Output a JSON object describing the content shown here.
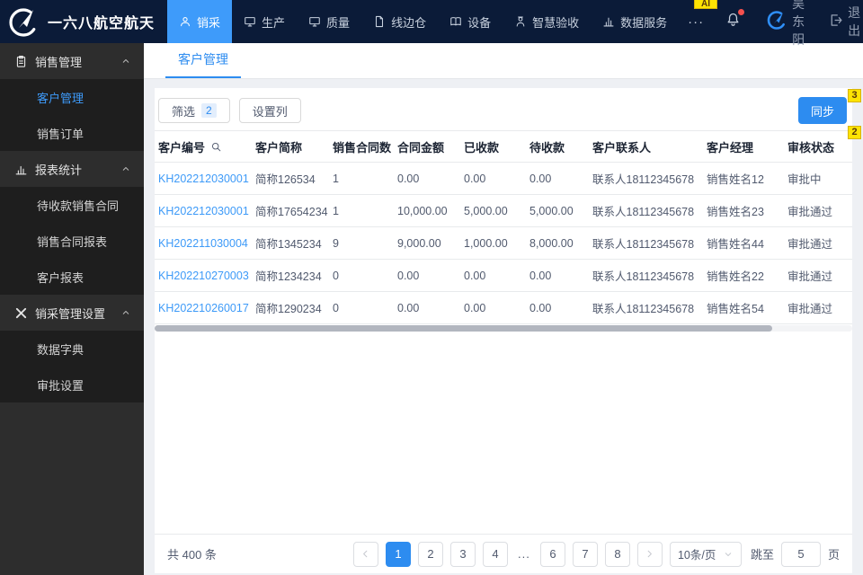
{
  "topbar": {
    "brand": "一六八航空航天",
    "nav": [
      {
        "label": "销采",
        "icon": "user-icon",
        "active": true
      },
      {
        "label": "生产",
        "icon": "monitor-icon",
        "active": false
      },
      {
        "label": "质量",
        "icon": "monitor-icon",
        "active": false
      },
      {
        "label": "线边仓",
        "icon": "doc-icon",
        "active": false
      },
      {
        "label": "设备",
        "icon": "book-icon",
        "active": false
      },
      {
        "label": "智慧验收",
        "icon": "inspector-icon",
        "active": false
      },
      {
        "label": "数据服务",
        "icon": "chart-icon",
        "active": false
      }
    ],
    "more": "···",
    "user": "吴东阳",
    "logout": "退出"
  },
  "sidebar": {
    "groups": [
      {
        "label": "销售管理",
        "icon": "clipboard-icon",
        "items": [
          {
            "label": "客户管理",
            "active": true
          },
          {
            "label": "销售订单",
            "active": false
          }
        ]
      },
      {
        "label": "报表统计",
        "icon": "bar-chart-icon",
        "items": [
          {
            "label": "待收款销售合同",
            "active": false
          },
          {
            "label": "销售合同报表",
            "active": false
          },
          {
            "label": "客户报表",
            "active": false
          }
        ]
      },
      {
        "label": "销采管理设置",
        "icon": "tools-icon",
        "items": [
          {
            "label": "数据字典",
            "active": false
          },
          {
            "label": "审批设置",
            "active": false
          }
        ]
      }
    ]
  },
  "main": {
    "tab": "客户管理",
    "toolbar": {
      "filter": "筛选",
      "filter_count": "2",
      "columns": "设置列",
      "sync": "同步"
    },
    "table": {
      "headers": [
        "客户编号",
        "客户简称",
        "销售合同数",
        "合同金额",
        "已收款",
        "待收款",
        "客户联系人",
        "客户经理",
        "审核状态"
      ],
      "rows": [
        [
          "KH202212030001",
          "简称126534",
          "1",
          "0.00",
          "0.00",
          "0.00",
          "联系人18112345678",
          "销售姓名12",
          "审批中"
        ],
        [
          "KH202212030001",
          "简称17654234",
          "1",
          "10,000.00",
          "5,000.00",
          "5,000.00",
          "联系人18112345678",
          "销售姓名23",
          "审批通过"
        ],
        [
          "KH202211030004",
          "简称1345234",
          "9",
          "9,000.00",
          "1,000.00",
          "8,000.00",
          "联系人18112345678",
          "销售姓名44",
          "审批通过"
        ],
        [
          "KH202210270003",
          "简称1234234",
          "0",
          "0.00",
          "0.00",
          "0.00",
          "联系人18112345678",
          "销售姓名22",
          "审批通过"
        ],
        [
          "KH202210260017",
          "简称1290234",
          "0",
          "0.00",
          "0.00",
          "0.00",
          "联系人18112345678",
          "销售姓名54",
          "审批通过"
        ]
      ]
    },
    "pagination": {
      "total": "共 400 条",
      "pages": [
        "1",
        "2",
        "3",
        "4",
        "...",
        "6",
        "7",
        "8"
      ],
      "active_page": "1",
      "page_size": "10条/页",
      "jump_label": "跳至",
      "jump_value": "5",
      "jump_suffix": "页"
    }
  },
  "marks": {
    "top": "AI",
    "sync": "3",
    "panel": "2"
  },
  "colors": {
    "topbar_bg": "#0b1b38",
    "nav_active": "#3e9bfa",
    "accent": "#2d8cf0",
    "sidebar_bg": "#2d2d2d",
    "sidebar_sub_bg": "#1e1e1e",
    "mark_yellow": "#fde403"
  }
}
